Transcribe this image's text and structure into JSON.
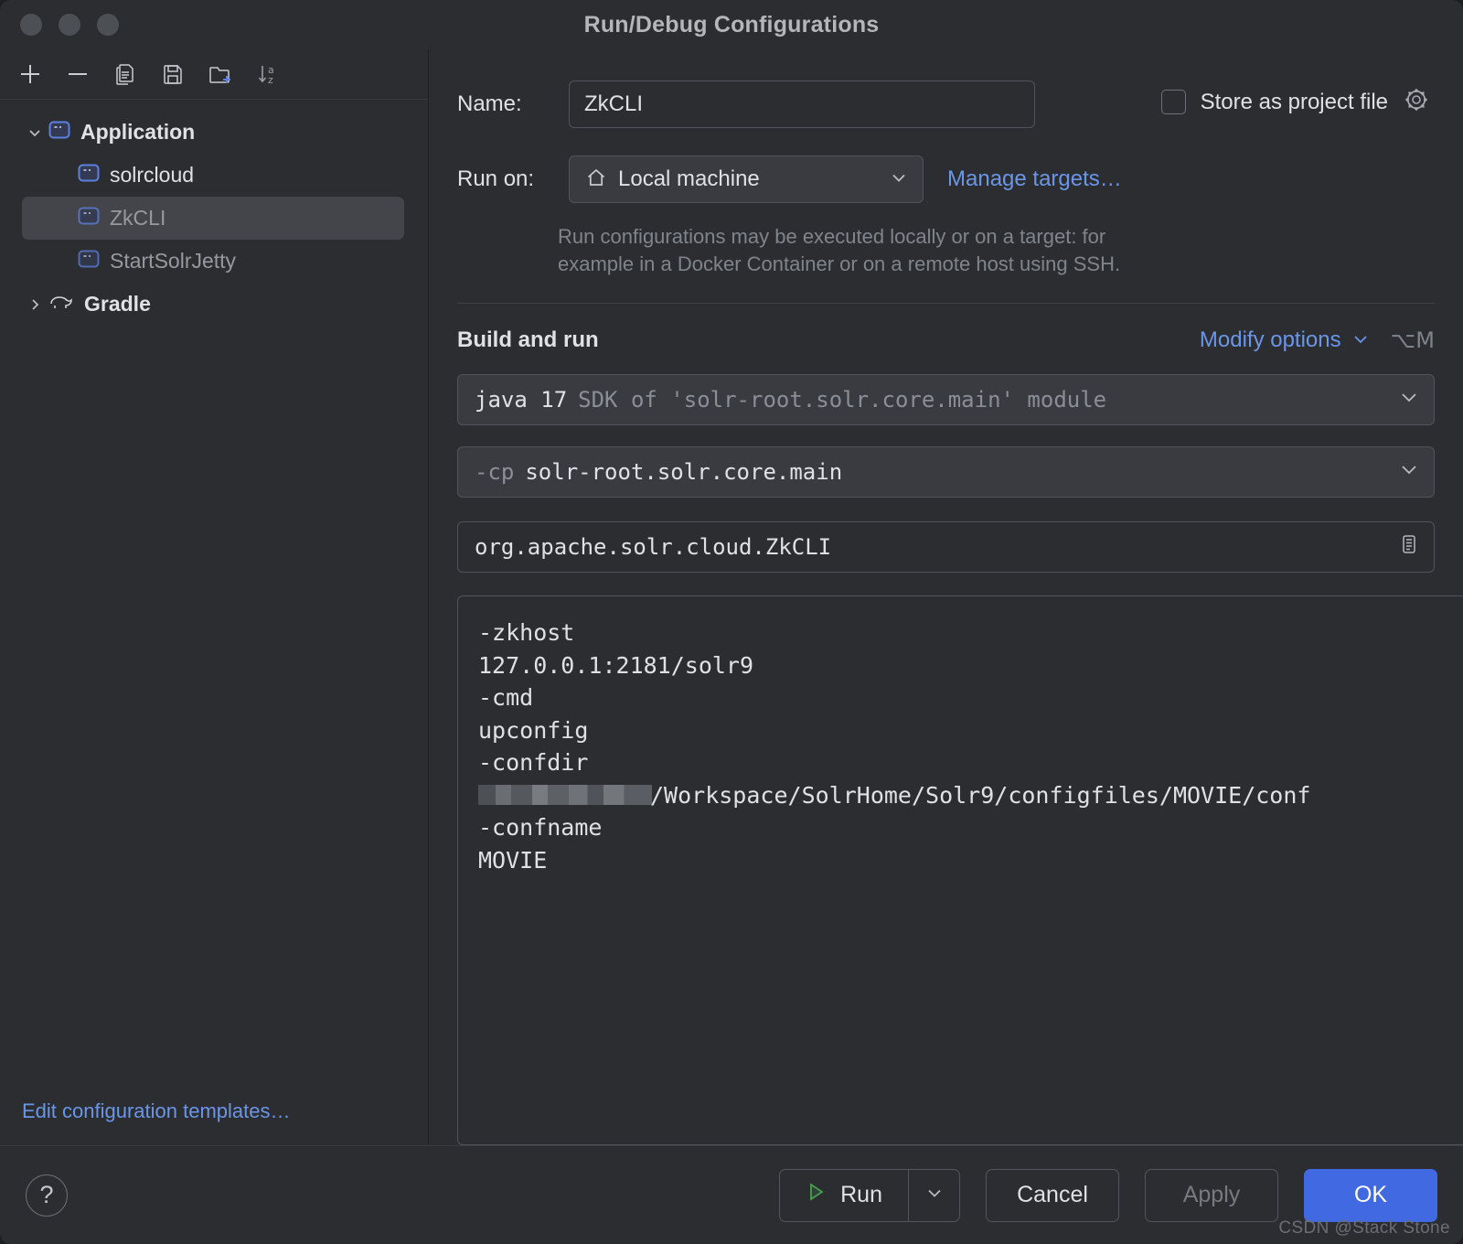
{
  "window": {
    "title": "Run/Debug Configurations",
    "traffic_lights": [
      "close",
      "minimize",
      "zoom"
    ]
  },
  "sidebar": {
    "toolbar": [
      {
        "name": "add-configuration-button",
        "icon": "plus-icon"
      },
      {
        "name": "remove-configuration-button",
        "icon": "minus-icon"
      },
      {
        "name": "copy-configuration-button",
        "icon": "copy-icon"
      },
      {
        "name": "save-configuration-button",
        "icon": "save-icon"
      },
      {
        "name": "new-folder-button",
        "icon": "folder-add-icon"
      },
      {
        "name": "sort-configurations-button",
        "icon": "sort-az-icon"
      }
    ],
    "tree": [
      {
        "label": "Application",
        "level": 0,
        "expanded": true,
        "selected": false,
        "dim": false,
        "bold": true,
        "icon": "application-icon",
        "chevron": "chevron-down-icon"
      },
      {
        "label": "solrcloud",
        "level": 1,
        "expanded": null,
        "selected": false,
        "dim": false,
        "bold": false,
        "icon": "application-icon",
        "chevron": null
      },
      {
        "label": "ZkCLI",
        "level": 1,
        "expanded": null,
        "selected": true,
        "dim": true,
        "bold": false,
        "icon": "application-icon",
        "chevron": null
      },
      {
        "label": "StartSolrJetty",
        "level": 1,
        "expanded": null,
        "selected": false,
        "dim": true,
        "bold": false,
        "icon": "application-icon",
        "chevron": null
      },
      {
        "label": "Gradle",
        "level": 0,
        "expanded": false,
        "selected": false,
        "dim": false,
        "bold": true,
        "icon": "gradle-elephant-icon",
        "chevron": "chevron-right-icon"
      }
    ],
    "edit_templates_link": "Edit configuration templates…"
  },
  "form": {
    "name_label": "Name:",
    "name_value": "ZkCLI",
    "name_placeholder": "Name",
    "store_as_project_file_label": "Store as project file",
    "store_as_project_file_checked": false,
    "store_gear_icon": "gear-icon",
    "run_on_label": "Run on:",
    "run_on_value": "Local machine",
    "run_on_icon": "home-icon",
    "manage_targets_link": "Manage targets…",
    "hint_line1": "Run configurations may be executed locally or on a target: for",
    "hint_line2": "example in a Docker Container or on a remote host using SSH."
  },
  "build_and_run": {
    "section_title": "Build and run",
    "modify_options_label": "Modify options",
    "modify_options_shortcut": "⌥M",
    "sdk_primary": "java 17",
    "sdk_secondary": "SDK of 'solr-root.solr.core.main' module",
    "classpath_prefix": "-cp",
    "classpath_value": "solr-root.solr.core.main",
    "main_class_value": "org.apache.solr.cloud.ZkCLI",
    "main_class_expand_icon": "expand-editor-icon",
    "program_arguments": {
      "line1": "-zkhost",
      "line2": "127.0.0.1:2181/solr9",
      "line3": "-cmd",
      "line4": "upconfig",
      "line5": "-confdir",
      "line6_redacted_prefix": "[redacted]",
      "line6_suffix": "/Workspace/SolrHome/Solr9/configfiles/MOVIE/conf",
      "line7": "-confname",
      "line8": "MOVIE"
    }
  },
  "footer": {
    "help_label": "?",
    "run_label": "Run",
    "run_icon": "play-triangle-icon",
    "run_dropdown_icon": "chevron-down-icon",
    "cancel_label": "Cancel",
    "apply_label": "Apply",
    "apply_enabled": false,
    "ok_label": "OK",
    "watermark": "CSDN @Stack Stone"
  },
  "colors": {
    "window_bg": "#2b2d30",
    "accent_blue": "#4169e1",
    "link_blue": "#6b96e8",
    "field_bg": "#393b40",
    "selection_bg": "#43454a",
    "text_primary": "#dfe1e5",
    "text_dim": "#8a8f95",
    "run_green": "#499c54"
  }
}
